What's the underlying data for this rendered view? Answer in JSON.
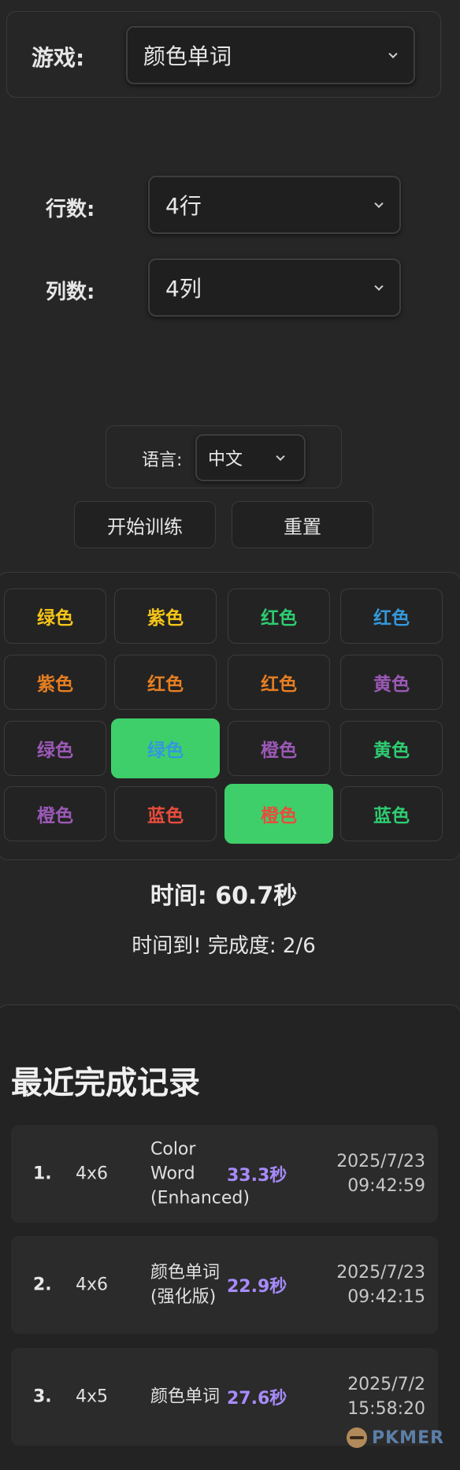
{
  "game": {
    "label": "游戏:",
    "selected": "颜色单词"
  },
  "rows": {
    "label": "行数:",
    "selected": "4行"
  },
  "cols": {
    "label": "列数:",
    "selected": "4列"
  },
  "language": {
    "label": "语言:",
    "selected": "中文"
  },
  "buttons": {
    "start": "开始训练",
    "reset": "重置"
  },
  "grid": {
    "cells": [
      {
        "text": "绿色",
        "color": "#f5c518",
        "selected": false
      },
      {
        "text": "紫色",
        "color": "#f5c518",
        "selected": false
      },
      {
        "text": "红色",
        "color": "#2ecc71",
        "selected": false
      },
      {
        "text": "红色",
        "color": "#3498db",
        "selected": false
      },
      {
        "text": "紫色",
        "color": "#e67e22",
        "selected": false
      },
      {
        "text": "红色",
        "color": "#e67e22",
        "selected": false
      },
      {
        "text": "红色",
        "color": "#e67e22",
        "selected": false
      },
      {
        "text": "黄色",
        "color": "#9b59b6",
        "selected": false
      },
      {
        "text": "绿色",
        "color": "#9b59b6",
        "selected": false
      },
      {
        "text": "绿色",
        "color": "#3498db",
        "selected": true
      },
      {
        "text": "橙色",
        "color": "#9b59b6",
        "selected": false
      },
      {
        "text": "黄色",
        "color": "#2ecc71",
        "selected": false
      },
      {
        "text": "橙色",
        "color": "#9b59b6",
        "selected": false
      },
      {
        "text": "蓝色",
        "color": "#e74c3c",
        "selected": false
      },
      {
        "text": "橙色",
        "color": "#e74c3c",
        "selected": true
      },
      {
        "text": "蓝色",
        "color": "#2ecc71",
        "selected": false
      }
    ],
    "selected_color": "#3ecf6a"
  },
  "timer": "时间: 60.7秒",
  "status": "时间到! 完成度: 2/6",
  "records": {
    "title": "最近完成记录",
    "items": [
      {
        "num": "1.",
        "size": "4x6",
        "name": "Color Word (Enhanced)",
        "time": "33.3秒",
        "date": "2025/7/23",
        "clock": "09:42:59"
      },
      {
        "num": "2.",
        "size": "4x6",
        "name": "颜色单词(强化版)",
        "time": "22.9秒",
        "date": "2025/7/23",
        "clock": "09:42:15"
      },
      {
        "num": "3.",
        "size": "4x5",
        "name": "颜色单词",
        "time": "27.6秒",
        "date": "2025/7/2",
        "clock": "15:58:20"
      }
    ]
  },
  "logo": {
    "text": "PKMER",
    "icon": "pkmer-logo-icon"
  },
  "colors": {
    "accent_purple": "#a78bfa",
    "selected_green": "#3ecf6a",
    "background": "#262626"
  }
}
